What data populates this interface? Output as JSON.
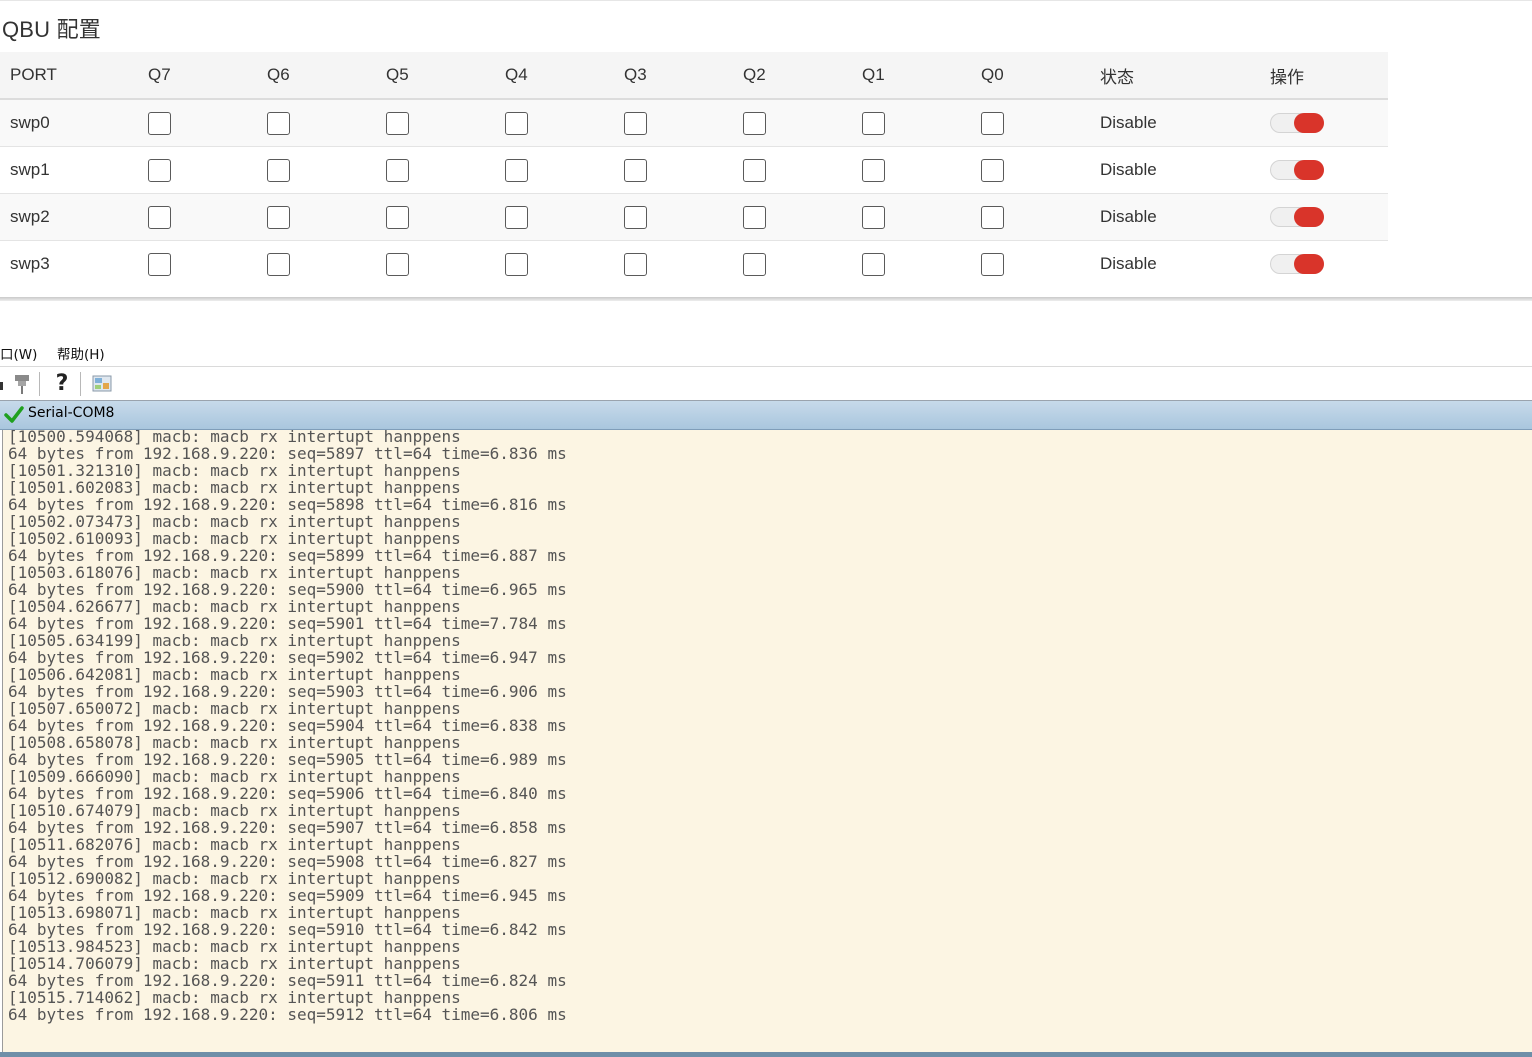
{
  "qbu": {
    "title": "QBU 配置",
    "headers": [
      "PORT",
      "Q7",
      "Q6",
      "Q5",
      "Q4",
      "Q3",
      "Q2",
      "Q1",
      "Q0",
      "状态",
      "操作"
    ],
    "rows": [
      {
        "port": "swp0",
        "status": "Disable"
      },
      {
        "port": "swp1",
        "status": "Disable"
      },
      {
        "port": "swp2",
        "status": "Disable"
      },
      {
        "port": "swp3",
        "status": "Disable"
      }
    ],
    "toggle_color": "#d9342a"
  },
  "terminal": {
    "menu": {
      "window": "口(W)",
      "help": "帮助(H)"
    },
    "toolbar": {
      "icons": [
        "pin-icon",
        "help-icon",
        "screen-icon"
      ],
      "help_glyph": "?"
    },
    "tab": {
      "label": "Serial-COM8",
      "status_icon": "checkmark-icon",
      "status_color": "#1fa01f"
    },
    "console_lines": [
      "[10500.594068] macb: macb rx intertupt hanppens",
      "64 bytes from 192.168.9.220: seq=5897 ttl=64 time=6.836 ms",
      "[10501.321310] macb: macb rx intertupt hanppens",
      "[10501.602083] macb: macb rx intertupt hanppens",
      "64 bytes from 192.168.9.220: seq=5898 ttl=64 time=6.816 ms",
      "[10502.073473] macb: macb rx intertupt hanppens",
      "[10502.610093] macb: macb rx intertupt hanppens",
      "64 bytes from 192.168.9.220: seq=5899 ttl=64 time=6.887 ms",
      "[10503.618076] macb: macb rx intertupt hanppens",
      "64 bytes from 192.168.9.220: seq=5900 ttl=64 time=6.965 ms",
      "[10504.626677] macb: macb rx intertupt hanppens",
      "64 bytes from 192.168.9.220: seq=5901 ttl=64 time=7.784 ms",
      "[10505.634199] macb: macb rx intertupt hanppens",
      "64 bytes from 192.168.9.220: seq=5902 ttl=64 time=6.947 ms",
      "[10506.642081] macb: macb rx intertupt hanppens",
      "64 bytes from 192.168.9.220: seq=5903 ttl=64 time=6.906 ms",
      "[10507.650072] macb: macb rx intertupt hanppens",
      "64 bytes from 192.168.9.220: seq=5904 ttl=64 time=6.838 ms",
      "[10508.658078] macb: macb rx intertupt hanppens",
      "64 bytes from 192.168.9.220: seq=5905 ttl=64 time=6.989 ms",
      "[10509.666090] macb: macb rx intertupt hanppens",
      "64 bytes from 192.168.9.220: seq=5906 ttl=64 time=6.840 ms",
      "[10510.674079] macb: macb rx intertupt hanppens",
      "64 bytes from 192.168.9.220: seq=5907 ttl=64 time=6.858 ms",
      "[10511.682076] macb: macb rx intertupt hanppens",
      "64 bytes from 192.168.9.220: seq=5908 ttl=64 time=6.827 ms",
      "[10512.690082] macb: macb rx intertupt hanppens",
      "64 bytes from 192.168.9.220: seq=5909 ttl=64 time=6.945 ms",
      "[10513.698071] macb: macb rx intertupt hanppens",
      "64 bytes from 192.168.9.220: seq=5910 ttl=64 time=6.842 ms",
      "[10513.984523] macb: macb rx intertupt hanppens",
      "[10514.706079] macb: macb rx intertupt hanppens",
      "64 bytes from 192.168.9.220: seq=5911 ttl=64 time=6.824 ms",
      "[10515.714062] macb: macb rx intertupt hanppens",
      "64 bytes from 192.168.9.220: seq=5912 ttl=64 time=6.806 ms"
    ]
  }
}
